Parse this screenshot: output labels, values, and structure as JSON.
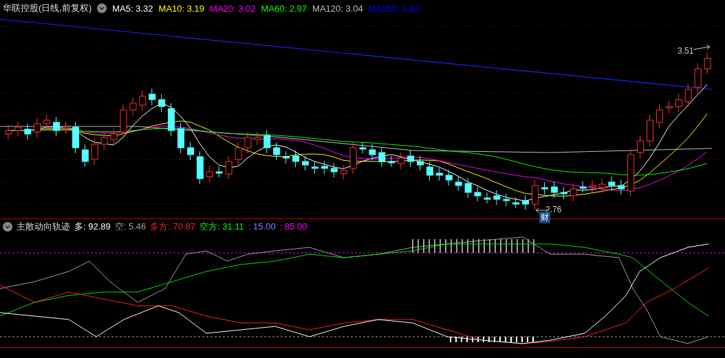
{
  "header": {
    "title": "华联控股(日线,前复权)",
    "indicators": [
      {
        "label": "MA5: 3.32",
        "color": "#ffffff"
      },
      {
        "label": "MA10: 3.19",
        "color": "#ffff00"
      },
      {
        "label": "MA20: 3.02",
        "color": "#ff00ff"
      },
      {
        "label": "MA60: 2.97",
        "color": "#00ff00"
      },
      {
        "label": "MA120: 3.04",
        "color": "#c0c0c0"
      },
      {
        "label": "MA250: 3.32",
        "color": "#0000ff"
      }
    ]
  },
  "price_chart": {
    "high_marker": "3.51",
    "low_marker": "2.76",
    "event_badge": "财"
  },
  "indicator_header": {
    "title": "主散动向轨迹",
    "values": [
      {
        "label": "多: 92.89",
        "color": "#ffffff"
      },
      {
        "label": "空: 5.46",
        "color": "#a0a0a0"
      },
      {
        "label": "多方: 70.87",
        "color": "#ff2020"
      },
      {
        "label": "空方: 31.11",
        "color": "#00ff00"
      },
      {
        "label": ": 15.00",
        "color": "#8080ff"
      },
      {
        "label": ": 85.00",
        "color": "#ff00ff"
      }
    ]
  }
}
